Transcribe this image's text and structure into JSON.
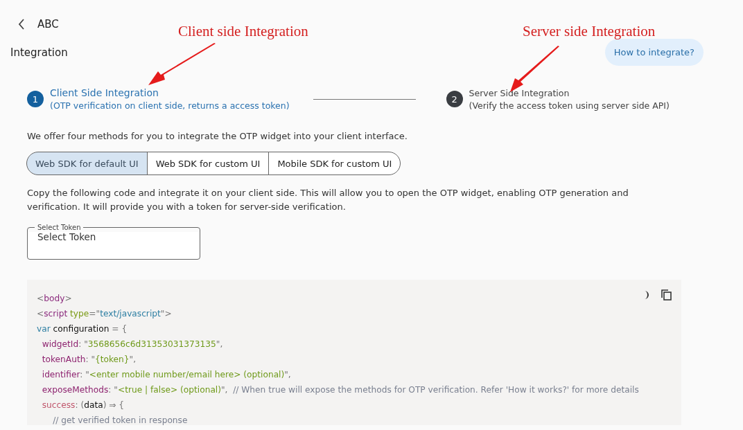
{
  "header": {
    "title": "ABC"
  },
  "page_title": "Integration",
  "help_button": "How to integrate?",
  "annotations": [
    {
      "text": "Client side Integration"
    },
    {
      "text": "Server side Integration"
    }
  ],
  "steps": [
    {
      "number": "1",
      "title": "Client Side Integration",
      "subtitle": "(OTP verification on client side, returns a access token)",
      "selected": true
    },
    {
      "number": "2",
      "title": "Server Side Integration",
      "subtitle": "(Verify the access token using server side API)",
      "selected": false
    }
  ],
  "intro": "We offer four methods for you to integrate the OTP widget into your client interface.",
  "tabs": [
    {
      "label": "Web SDK for default UI",
      "selected": true
    },
    {
      "label": "Web SDK for custom UI",
      "selected": false
    },
    {
      "label": "Mobile SDK for custom UI",
      "selected": false
    }
  ],
  "instructions": "Copy the following code and integrate it on your client side. This will allow you to open the OTP widget, enabling OTP generation and verification. It will provide you with a token for server-side verification.",
  "token_select": {
    "label": "Select Token",
    "value": "Select Token"
  },
  "code": [
    [
      {
        "kind": "punct",
        "text": "<"
      },
      {
        "kind": "tag",
        "text": "body"
      },
      {
        "kind": "punct",
        "text": ">"
      }
    ],
    [
      {
        "kind": "punct",
        "text": "<"
      },
      {
        "kind": "tag",
        "text": "script"
      },
      {
        "kind": "attr",
        "text": " type"
      },
      {
        "kind": "punct",
        "text": "=\""
      },
      {
        "kind": "value",
        "text": "text/javascript"
      },
      {
        "kind": "punct",
        "text": "\">"
      }
    ],
    [
      {
        "kind": "keyword",
        "text": "var"
      },
      {
        "kind": "plain",
        "text": " configuration "
      },
      {
        "kind": "punct",
        "text": "= {"
      }
    ],
    [
      {
        "kind": "key",
        "text": "  widgetId"
      },
      {
        "kind": "punct",
        "text": ": \""
      },
      {
        "kind": "string",
        "text": "3568656c6d31353031373135"
      },
      {
        "kind": "punct",
        "text": "\","
      }
    ],
    [
      {
        "kind": "key",
        "text": "  tokenAuth"
      },
      {
        "kind": "punct",
        "text": ": \""
      },
      {
        "kind": "string",
        "text": "{token}"
      },
      {
        "kind": "punct",
        "text": "\","
      }
    ],
    [
      {
        "kind": "key",
        "text": "  identifier"
      },
      {
        "kind": "punct",
        "text": ": \""
      },
      {
        "kind": "string",
        "text": "<enter mobile number/email here> (optional)"
      },
      {
        "kind": "punct",
        "text": "\","
      }
    ],
    [
      {
        "kind": "key",
        "text": "  exposeMethods"
      },
      {
        "kind": "punct",
        "text": ": \""
      },
      {
        "kind": "string",
        "text": "<true | false> (optional)"
      },
      {
        "kind": "punct",
        "text": "\",  "
      },
      {
        "kind": "comment",
        "text": "// When true will expose the methods for OTP verification. Refer 'How it works?' for more details"
      }
    ],
    [
      {
        "kind": "callback",
        "text": "  success"
      },
      {
        "kind": "punct",
        "text": ": ("
      },
      {
        "kind": "plain",
        "text": "data"
      },
      {
        "kind": "punct",
        "text": ") ⇒ {"
      }
    ],
    [
      {
        "kind": "comment",
        "text": "      // get verified token in response"
      }
    ]
  ]
}
